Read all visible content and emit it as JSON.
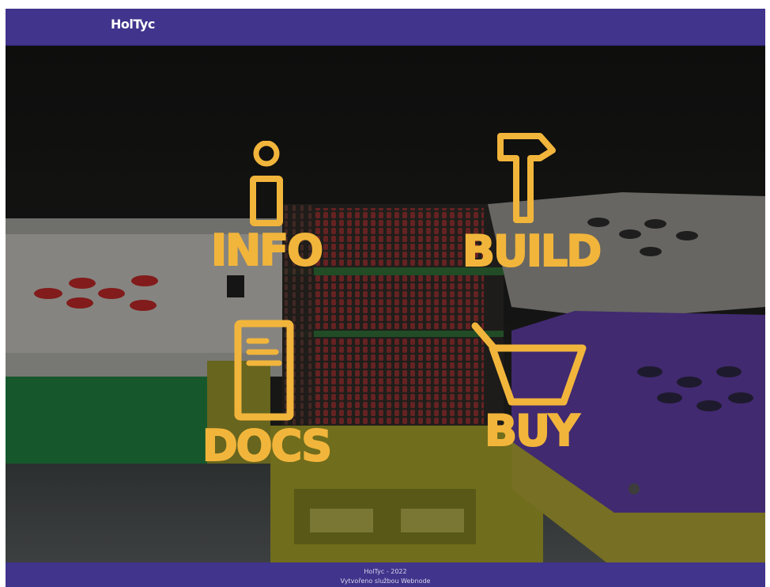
{
  "header": {
    "logo_text": "HolTyc"
  },
  "tiles": [
    {
      "label": "INFO",
      "icon": "info-icon"
    },
    {
      "label": "BUILD",
      "icon": "hammer-icon"
    },
    {
      "label": "DOCS",
      "icon": "document-icon"
    },
    {
      "label": "BUY",
      "icon": "shopping-cart-icon"
    }
  ],
  "footer": {
    "copyright": "HolTyc -  2022",
    "credit": "Vytvořeno službou Webnode"
  },
  "colors": {
    "brand_bar": "#40348c",
    "accent": "#f2b53b",
    "hero_background": "#1b1b1a"
  }
}
